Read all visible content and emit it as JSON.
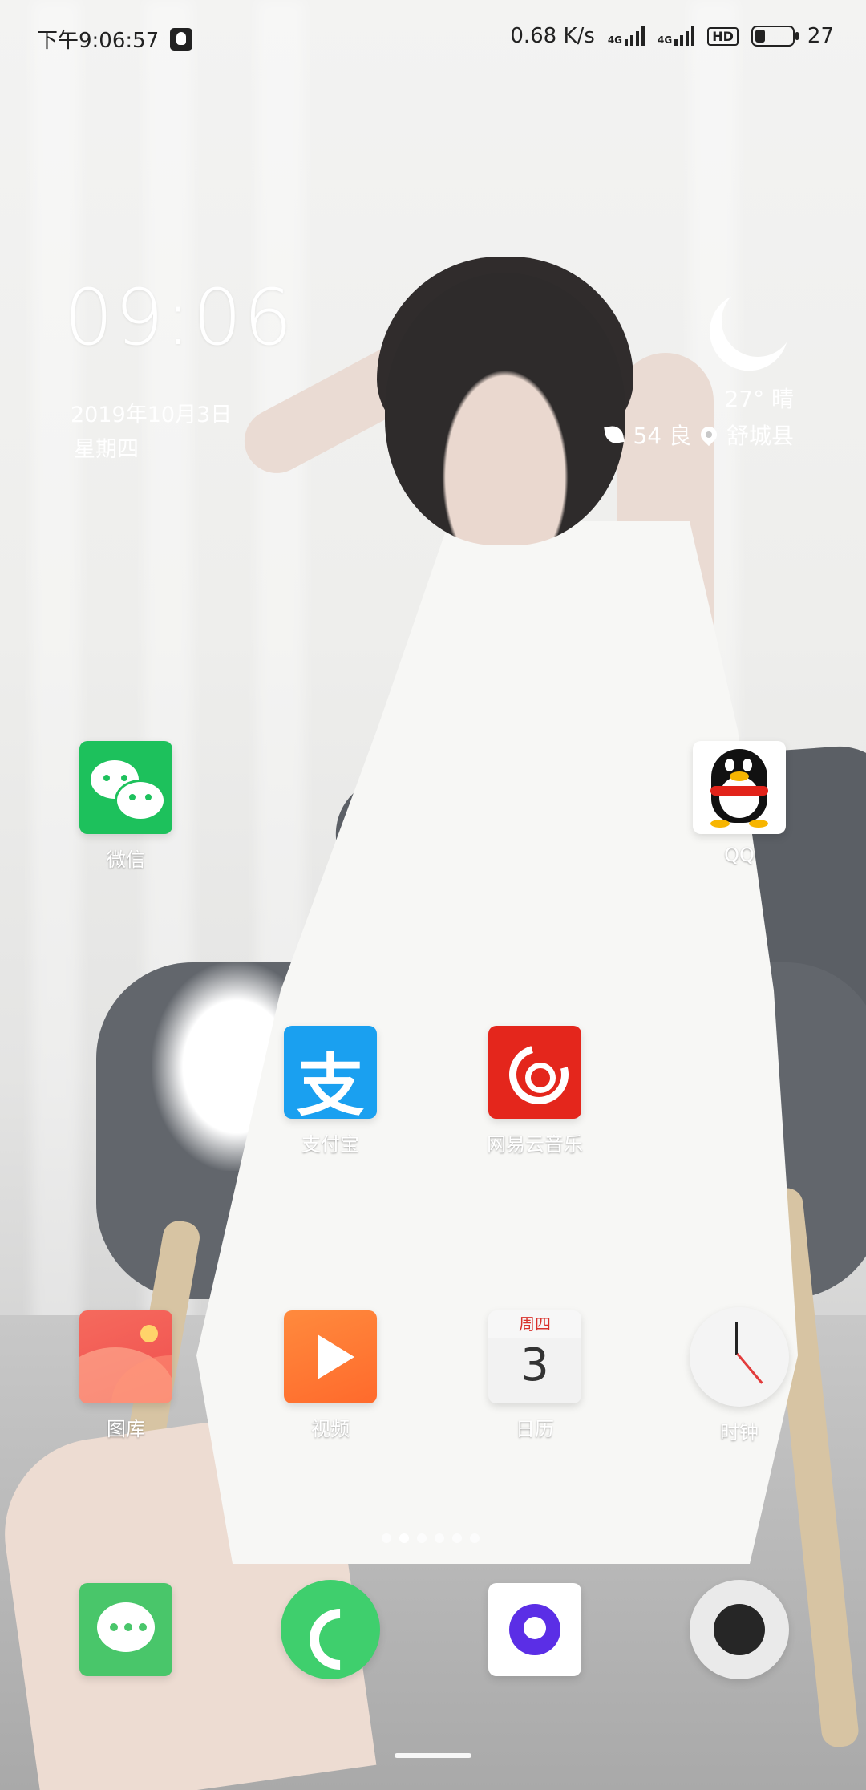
{
  "status_bar": {
    "time": "下午9:06:57",
    "net_speed": "0.68 K/s",
    "signal1": "4G",
    "signal2": "4G",
    "hd_badge": "HD",
    "battery": "27"
  },
  "clock_widget": {
    "time": "09:06",
    "date": "2019年10月3日",
    "weekday": "星期四",
    "weather_icon": "moon-icon",
    "temperature": "27° 晴",
    "aqi": "54 良",
    "location": "舒城县"
  },
  "apps": [
    {
      "label": "微信",
      "icon": "wechat-icon"
    },
    {
      "label": "QQ",
      "icon": "qq-penguin-icon"
    },
    {
      "label": "支付宝",
      "icon": "alipay-icon",
      "glyph": "支"
    },
    {
      "label": "网易云音乐",
      "icon": "netease-music-icon"
    },
    {
      "label": "图库",
      "icon": "gallery-icon"
    },
    {
      "label": "视频",
      "icon": "video-play-icon"
    },
    {
      "label": "日历",
      "icon": "calendar-icon",
      "header": "周四",
      "day": "3"
    },
    {
      "label": "时钟",
      "icon": "clock-icon"
    }
  ],
  "dock": [
    {
      "icon": "messages-icon"
    },
    {
      "icon": "phone-icon"
    },
    {
      "icon": "browser-icon"
    },
    {
      "icon": "camera-icon"
    }
  ],
  "pager": {
    "pages": 6,
    "active": 2
  },
  "colors": {
    "wechat": "#1dc15c",
    "alipay": "#1aa0f0",
    "netease": "#e4261c",
    "video": "#ff7a33",
    "phone": "#3fcf6d",
    "browser_accent": "#5b2ee6"
  }
}
